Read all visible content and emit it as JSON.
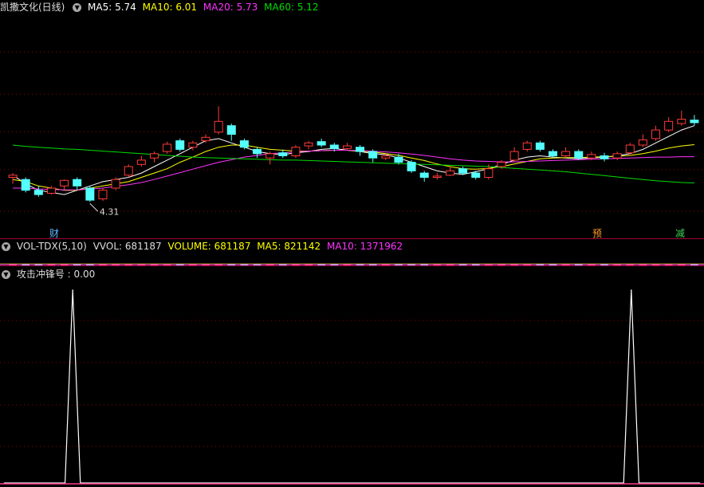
{
  "price_panel": {
    "title": "凯撒文化(日线)",
    "ma5_label": "MA5: 5.74",
    "ma10_label": "MA10: 6.01",
    "ma20_label": "MA20: 5.73",
    "ma60_label": "MA60: 5.12",
    "low_marker": "4.31",
    "markers": [
      {
        "text": "财",
        "color": "#5fb8ff"
      },
      {
        "text": "预",
        "color": "#ff9a2a"
      },
      {
        "text": "减",
        "color": "#39d353"
      }
    ]
  },
  "vol_panel": {
    "name": "VOL-TDX(5,10)",
    "vvol": "VVOL: 681187",
    "volume": "VOLUME: 681187",
    "ma5": "MA5: 821142",
    "ma10": "MA10: 1371962"
  },
  "signal_panel": {
    "name": "攻击冲锋号",
    "value": ": 0.00"
  },
  "colors": {
    "up": "#ff3a3a",
    "down": "#54ffff",
    "ma5": "#ffffff",
    "ma10": "#ffff00",
    "ma20": "#ff33ff",
    "ma60": "#00dd00",
    "grid": "#8b0000"
  },
  "chart_data": [
    {
      "type": "candlestick",
      "title": "凯撒文化(日线)",
      "series": [
        {
          "name": "MA5",
          "values": [
            5.3,
            5.1,
            4.95,
            4.9,
            4.85,
            4.95,
            5.05,
            5.15,
            5.2,
            5.25,
            5.35,
            5.5,
            5.65,
            5.8,
            5.95,
            6.1,
            6.15,
            6.05,
            5.95,
            5.85,
            5.8,
            5.78,
            5.82,
            5.85,
            5.9,
            5.92,
            5.88,
            5.85,
            5.8,
            5.78,
            5.7,
            5.6,
            5.5,
            5.4,
            5.35,
            5.32,
            5.38,
            5.45,
            5.55,
            5.65,
            5.72,
            5.75,
            5.72,
            5.7,
            5.68,
            5.7,
            5.72,
            5.75,
            5.8,
            5.9,
            6.05,
            6.2,
            6.35,
            6.45
          ]
        },
        {
          "name": "MA10",
          "values": [
            5.2,
            5.15,
            5.05,
            5.0,
            4.95,
            4.95,
            5.0,
            5.05,
            5.1,
            5.15,
            5.25,
            5.35,
            5.45,
            5.6,
            5.72,
            5.85,
            5.95,
            6.0,
            6.0,
            5.95,
            5.9,
            5.88,
            5.86,
            5.86,
            5.87,
            5.88,
            5.88,
            5.86,
            5.84,
            5.8,
            5.76,
            5.7,
            5.64,
            5.56,
            5.5,
            5.45,
            5.44,
            5.46,
            5.5,
            5.56,
            5.62,
            5.68,
            5.7,
            5.71,
            5.71,
            5.72,
            5.73,
            5.74,
            5.76,
            5.8,
            5.86,
            5.93,
            5.98,
            6.01
          ]
        },
        {
          "name": "MA20",
          "values": [
            5.0,
            5.0,
            4.98,
            4.97,
            4.96,
            4.96,
            4.98,
            5.0,
            5.04,
            5.08,
            5.13,
            5.2,
            5.28,
            5.36,
            5.44,
            5.52,
            5.6,
            5.66,
            5.72,
            5.76,
            5.8,
            5.82,
            5.84,
            5.86,
            5.87,
            5.88,
            5.88,
            5.87,
            5.86,
            5.84,
            5.82,
            5.79,
            5.76,
            5.72,
            5.68,
            5.65,
            5.63,
            5.62,
            5.61,
            5.61,
            5.62,
            5.63,
            5.64,
            5.65,
            5.66,
            5.67,
            5.68,
            5.69,
            5.7,
            5.71,
            5.72,
            5.72,
            5.73,
            5.73
          ]
        },
        {
          "name": "MA60",
          "values": [
            6.0,
            5.97,
            5.95,
            5.93,
            5.91,
            5.9,
            5.88,
            5.86,
            5.84,
            5.82,
            5.8,
            5.78,
            5.76,
            5.74,
            5.72,
            5.71,
            5.7,
            5.69,
            5.68,
            5.67,
            5.66,
            5.65,
            5.65,
            5.64,
            5.63,
            5.62,
            5.61,
            5.6,
            5.59,
            5.58,
            5.57,
            5.56,
            5.55,
            5.54,
            5.53,
            5.52,
            5.51,
            5.5,
            5.48,
            5.46,
            5.44,
            5.42,
            5.4,
            5.38,
            5.35,
            5.32,
            5.29,
            5.26,
            5.23,
            5.2,
            5.17,
            5.15,
            5.13,
            5.12
          ]
        }
      ],
      "candles": [
        [
          5.25,
          5.3,
          5.35,
          5.1
        ],
        [
          5.2,
          4.95,
          5.25,
          4.9
        ],
        [
          4.95,
          4.85,
          5.05,
          4.8
        ],
        [
          4.88,
          5.0,
          5.05,
          4.85
        ],
        [
          5.05,
          5.18,
          5.2,
          4.95
        ],
        [
          5.2,
          5.05,
          5.25,
          4.95
        ],
        [
          5.0,
          4.72,
          5.05,
          4.68
        ],
        [
          4.75,
          4.95,
          5.0,
          4.7
        ],
        [
          5.0,
          5.2,
          5.25,
          4.95
        ],
        [
          5.3,
          5.5,
          5.55,
          5.25
        ],
        [
          5.55,
          5.65,
          5.75,
          5.5
        ],
        [
          5.7,
          5.8,
          5.85,
          5.6
        ],
        [
          5.85,
          6.02,
          6.08,
          5.8
        ],
        [
          6.1,
          5.9,
          6.15,
          5.85
        ],
        [
          5.95,
          6.05,
          6.1,
          5.88
        ],
        [
          6.1,
          6.18,
          6.25,
          6.05
        ],
        [
          6.3,
          6.55,
          6.9,
          6.25
        ],
        [
          6.45,
          6.25,
          6.5,
          6.1
        ],
        [
          6.1,
          5.95,
          6.15,
          5.9
        ],
        [
          5.9,
          5.8,
          5.95,
          5.7
        ],
        [
          5.7,
          5.8,
          5.85,
          5.55
        ],
        [
          5.82,
          5.75,
          5.9,
          5.7
        ],
        [
          5.75,
          5.95,
          6.0,
          5.7
        ],
        [
          5.98,
          6.05,
          6.1,
          5.9
        ],
        [
          6.08,
          6.0,
          6.15,
          5.95
        ],
        [
          6.0,
          5.92,
          6.05,
          5.85
        ],
        [
          5.92,
          5.98,
          6.05,
          5.88
        ],
        [
          5.95,
          5.85,
          6.0,
          5.75
        ],
        [
          5.85,
          5.7,
          5.9,
          5.6
        ],
        [
          5.7,
          5.75,
          5.8,
          5.65
        ],
        [
          5.72,
          5.6,
          5.8,
          5.55
        ],
        [
          5.6,
          5.4,
          5.65,
          5.35
        ],
        [
          5.35,
          5.25,
          5.4,
          5.15
        ],
        [
          5.25,
          5.28,
          5.35,
          5.2
        ],
        [
          5.3,
          5.4,
          5.5,
          5.28
        ],
        [
          5.45,
          5.35,
          5.5,
          5.3
        ],
        [
          5.35,
          5.25,
          5.4,
          5.2
        ],
        [
          5.25,
          5.45,
          5.55,
          5.2
        ],
        [
          5.5,
          5.6,
          5.65,
          5.45
        ],
        [
          5.65,
          5.85,
          5.95,
          5.6
        ],
        [
          5.9,
          6.05,
          6.1,
          5.85
        ],
        [
          6.05,
          5.9,
          6.1,
          5.85
        ],
        [
          5.85,
          5.75,
          5.9,
          5.7
        ],
        [
          5.75,
          5.85,
          5.95,
          5.7
        ],
        [
          5.85,
          5.7,
          5.9,
          5.65
        ],
        [
          5.7,
          5.78,
          5.85,
          5.65
        ],
        [
          5.75,
          5.68,
          5.82,
          5.62
        ],
        [
          5.7,
          5.8,
          5.85,
          5.65
        ],
        [
          5.82,
          6.0,
          6.05,
          5.78
        ],
        [
          6.0,
          6.12,
          6.25,
          5.95
        ],
        [
          6.15,
          6.35,
          6.45,
          6.1
        ],
        [
          6.35,
          6.55,
          6.65,
          6.3
        ],
        [
          6.5,
          6.6,
          6.8,
          6.45
        ],
        [
          6.58,
          6.52,
          6.7,
          6.45
        ]
      ],
      "candle_fields": [
        "open",
        "close",
        "high",
        "low"
      ],
      "ylim": [
        4.0,
        9.0
      ]
    },
    {
      "type": "bar",
      "title": "VOL-TDX(5,10)"
    },
    {
      "type": "line",
      "title": "攻击冲锋号",
      "values": [
        0,
        0,
        0,
        0,
        0,
        0,
        0,
        0,
        0,
        0,
        0,
        0,
        0,
        0,
        0,
        0,
        0,
        0,
        0,
        0,
        0,
        0,
        0,
        0,
        0,
        0,
        0,
        0,
        0,
        0,
        0,
        0,
        0,
        0,
        0,
        0,
        0,
        0,
        0,
        0,
        0,
        0,
        0,
        0,
        0,
        0,
        0,
        0,
        0,
        0,
        0,
        0,
        0,
        0
      ],
      "peaks": [
        {
          "index": 9,
          "value": 1
        },
        {
          "index": 82,
          "value": 1
        }
      ],
      "n_points": 92,
      "ylim": [
        0,
        1.05
      ]
    }
  ]
}
